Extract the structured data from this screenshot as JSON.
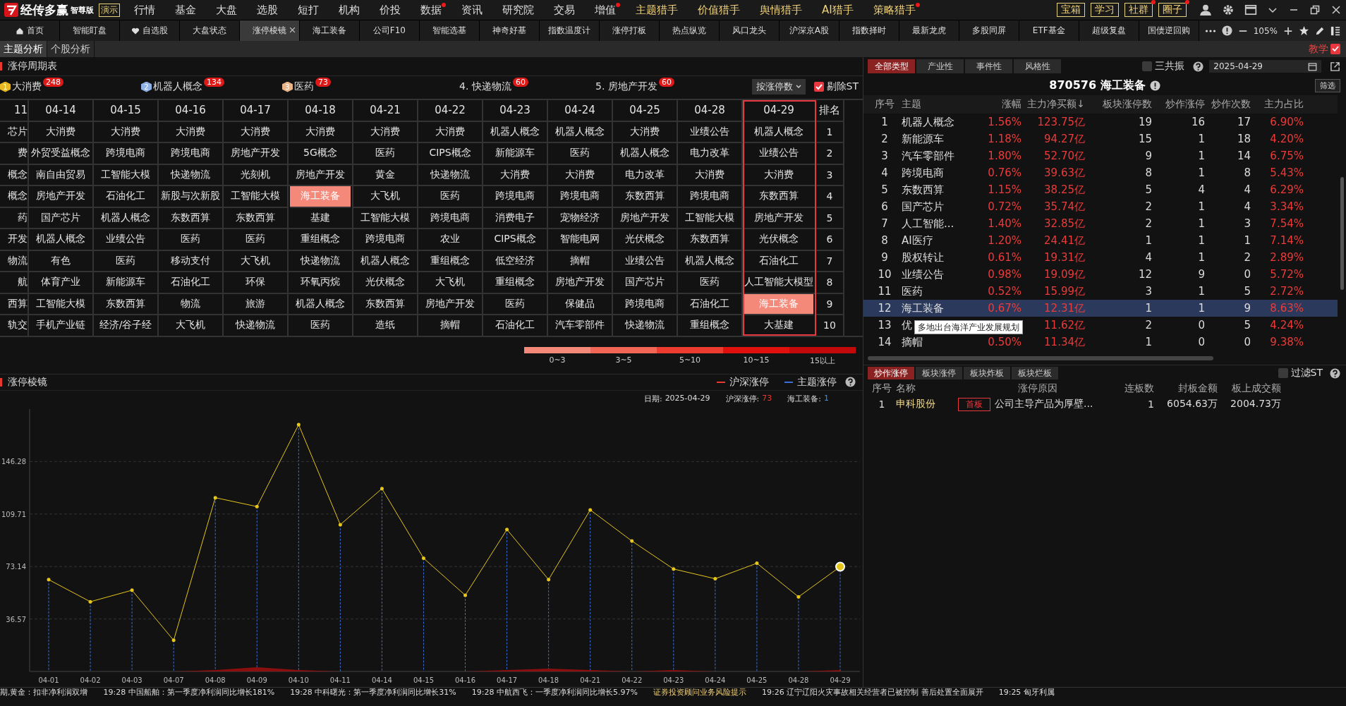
{
  "app": {
    "name": "经传多赢",
    "edition": "智尊版",
    "demo": "演示"
  },
  "nav": [
    {
      "label": "行情",
      "dot": false
    },
    {
      "label": "基金",
      "dot": false
    },
    {
      "label": "大盘",
      "dot": false
    },
    {
      "label": "选股",
      "dot": false
    },
    {
      "label": "短打",
      "dot": false
    },
    {
      "label": "机构",
      "dot": false
    },
    {
      "label": "价投",
      "dot": false
    },
    {
      "label": "数据",
      "dot": true
    },
    {
      "label": "资讯",
      "dot": false
    },
    {
      "label": "研究院",
      "dot": false
    },
    {
      "label": "交易",
      "dot": false
    },
    {
      "label": "增值",
      "dot": true
    },
    {
      "label": "主题猎手",
      "dot": false
    },
    {
      "label": "价值猎手",
      "dot": false
    },
    {
      "label": "舆情猎手",
      "dot": false
    },
    {
      "label": "AI猎手",
      "dot": false
    },
    {
      "label": "策略猎手",
      "dot": true
    }
  ],
  "nav_buttons": [
    {
      "label": "宝箱",
      "dot": false
    },
    {
      "label": "学习",
      "dot": false
    },
    {
      "label": "社群",
      "dot": true
    },
    {
      "label": "圈子",
      "dot": true
    }
  ],
  "tabs": [
    {
      "label": "首页",
      "selected": false
    },
    {
      "label": "智能盯盘",
      "selected": false
    },
    {
      "label": "自选股",
      "selected": false
    },
    {
      "label": "大盘状态",
      "selected": false
    },
    {
      "label": "涨停棱镜",
      "selected": true
    },
    {
      "label": "海工装备",
      "selected": false
    },
    {
      "label": "公司F10",
      "selected": false
    },
    {
      "label": "智能选基",
      "selected": false
    },
    {
      "label": "神奇好基",
      "selected": false
    },
    {
      "label": "指数温度计",
      "selected": false
    },
    {
      "label": "涨停打板",
      "selected": false
    },
    {
      "label": "热点纵览",
      "selected": false
    },
    {
      "label": "风口龙头",
      "selected": false
    },
    {
      "label": "沪深京A股",
      "selected": false
    },
    {
      "label": "指数择时",
      "selected": false
    },
    {
      "label": "最新龙虎",
      "selected": false
    },
    {
      "label": "多股同屏",
      "selected": false
    },
    {
      "label": "ETF基金",
      "selected": false
    },
    {
      "label": "超级复盘",
      "selected": false
    },
    {
      "label": "国债逆回购",
      "selected": false
    }
  ],
  "zoom": "105%",
  "subtabs": [
    {
      "label": "主题分析",
      "selected": true
    },
    {
      "label": "个股分析",
      "selected": false
    }
  ],
  "teach": "教学",
  "cycle_table": {
    "title": "涨停周期表",
    "top_themes": [
      {
        "kind": "medal",
        "rank": "1",
        "color": "#e8b923",
        "name": "大消费",
        "count": "248"
      },
      {
        "kind": "medal",
        "rank": "2",
        "color": "#8fb3e8",
        "name": "机器人概念",
        "count": "134"
      },
      {
        "kind": "medal",
        "rank": "3",
        "color": "#e8b48a",
        "name": "医药",
        "count": "73"
      },
      {
        "kind": "plain",
        "name": "4. 快递物流",
        "count": "60"
      },
      {
        "kind": "plain",
        "name": "5. 房地产开发",
        "count": "60"
      }
    ],
    "sort": "按涨停数",
    "exclude_st": {
      "label": "剔除ST",
      "checked": true
    },
    "columns": [
      {
        "date": "11",
        "selected": false,
        "cells": [
          {
            "text": "芯片",
            "hot": false
          },
          {
            "text": "费",
            "hot": false
          },
          {
            "text": "概念",
            "hot": false
          },
          {
            "text": "概念",
            "hot": false
          },
          {
            "text": "药",
            "hot": false
          },
          {
            "text": "开发",
            "hot": false
          },
          {
            "text": "物流",
            "hot": false
          },
          {
            "text": "航",
            "hot": false
          },
          {
            "text": "西算",
            "hot": false
          },
          {
            "text": "轨交",
            "hot": false
          }
        ]
      },
      {
        "date": "04-14",
        "selected": false,
        "cells": [
          {
            "text": "大消费",
            "hot": false
          },
          {
            "text": "外贸受益概念",
            "hot": false
          },
          {
            "text": "南自由贸易",
            "hot": false
          },
          {
            "text": "房地产开发",
            "hot": false
          },
          {
            "text": "国产芯片",
            "hot": false
          },
          {
            "text": "机器人概念",
            "hot": false
          },
          {
            "text": "有色",
            "hot": false
          },
          {
            "text": "体育产业",
            "hot": false
          },
          {
            "text": "工智能大模",
            "hot": false
          },
          {
            "text": "手机产业链",
            "hot": false
          }
        ]
      },
      {
        "date": "04-15",
        "selected": false,
        "cells": [
          {
            "text": "大消费",
            "hot": false
          },
          {
            "text": "跨境电商",
            "hot": false
          },
          {
            "text": "工智能大模",
            "hot": false
          },
          {
            "text": "石油化工",
            "hot": false
          },
          {
            "text": "机器人概念",
            "hot": false
          },
          {
            "text": "业绩公告",
            "hot": false
          },
          {
            "text": "医药",
            "hot": false
          },
          {
            "text": "新能源车",
            "hot": false
          },
          {
            "text": "东数西算",
            "hot": false
          },
          {
            "text": "经济/谷子经",
            "hot": false
          }
        ]
      },
      {
        "date": "04-16",
        "selected": false,
        "cells": [
          {
            "text": "大消费",
            "hot": false
          },
          {
            "text": "跨境电商",
            "hot": false
          },
          {
            "text": "快递物流",
            "hot": false
          },
          {
            "text": "新股与次新股",
            "hot": false
          },
          {
            "text": "东数西算",
            "hot": false
          },
          {
            "text": "医药",
            "hot": false
          },
          {
            "text": "移动支付",
            "hot": false
          },
          {
            "text": "石油化工",
            "hot": false
          },
          {
            "text": "物流",
            "hot": false
          },
          {
            "text": "大飞机",
            "hot": false
          }
        ]
      },
      {
        "date": "04-17",
        "selected": false,
        "cells": [
          {
            "text": "大消费",
            "hot": false
          },
          {
            "text": "房地产开发",
            "hot": false
          },
          {
            "text": "光刻机",
            "hot": false
          },
          {
            "text": "工智能大模",
            "hot": false
          },
          {
            "text": "东数西算",
            "hot": false
          },
          {
            "text": "医药",
            "hot": false
          },
          {
            "text": "大飞机",
            "hot": false
          },
          {
            "text": "环保",
            "hot": false
          },
          {
            "text": "旅游",
            "hot": false
          },
          {
            "text": "快递物流",
            "hot": false
          }
        ]
      },
      {
        "date": "04-18",
        "selected": false,
        "cells": [
          {
            "text": "大消费",
            "hot": false
          },
          {
            "text": "5G概念",
            "hot": false
          },
          {
            "text": "房地产开发",
            "hot": false
          },
          {
            "text": "海工装备",
            "hot": true
          },
          {
            "text": "基建",
            "hot": false
          },
          {
            "text": "重组概念",
            "hot": false
          },
          {
            "text": "快递物流",
            "hot": false
          },
          {
            "text": "环氧丙烷",
            "hot": false
          },
          {
            "text": "机器人概念",
            "hot": false
          },
          {
            "text": "医药",
            "hot": false
          }
        ]
      },
      {
        "date": "04-21",
        "selected": false,
        "cells": [
          {
            "text": "大消费",
            "hot": false
          },
          {
            "text": "医药",
            "hot": false
          },
          {
            "text": "黄金",
            "hot": false
          },
          {
            "text": "大飞机",
            "hot": false
          },
          {
            "text": "工智能大模",
            "hot": false
          },
          {
            "text": "跨境电商",
            "hot": false
          },
          {
            "text": "机器人概念",
            "hot": false
          },
          {
            "text": "光伏概念",
            "hot": false
          },
          {
            "text": "东数西算",
            "hot": false
          },
          {
            "text": "造纸",
            "hot": false
          }
        ]
      },
      {
        "date": "04-22",
        "selected": false,
        "cells": [
          {
            "text": "大消费",
            "hot": false
          },
          {
            "text": "CIPS概念",
            "hot": false
          },
          {
            "text": "快递物流",
            "hot": false
          },
          {
            "text": "医药",
            "hot": false
          },
          {
            "text": "跨境电商",
            "hot": false
          },
          {
            "text": "农业",
            "hot": false
          },
          {
            "text": "重组概念",
            "hot": false
          },
          {
            "text": "大飞机",
            "hot": false
          },
          {
            "text": "房地产开发",
            "hot": false
          },
          {
            "text": "摘帽",
            "hot": false
          }
        ]
      },
      {
        "date": "04-23",
        "selected": false,
        "cells": [
          {
            "text": "机器人概念",
            "hot": false
          },
          {
            "text": "新能源车",
            "hot": false
          },
          {
            "text": "大消费",
            "hot": false
          },
          {
            "text": "跨境电商",
            "hot": false
          },
          {
            "text": "消费电子",
            "hot": false
          },
          {
            "text": "CIPS概念",
            "hot": false
          },
          {
            "text": "低空经济",
            "hot": false
          },
          {
            "text": "重组概念",
            "hot": false
          },
          {
            "text": "医药",
            "hot": false
          },
          {
            "text": "石油化工",
            "hot": false
          }
        ]
      },
      {
        "date": "04-24",
        "selected": false,
        "cells": [
          {
            "text": "机器人概念",
            "hot": false
          },
          {
            "text": "医药",
            "hot": false
          },
          {
            "text": "大消费",
            "hot": false
          },
          {
            "text": "跨境电商",
            "hot": false
          },
          {
            "text": "宠物经济",
            "hot": false
          },
          {
            "text": "智能电网",
            "hot": false
          },
          {
            "text": "摘帽",
            "hot": false
          },
          {
            "text": "房地产开发",
            "hot": false
          },
          {
            "text": "保健品",
            "hot": false
          },
          {
            "text": "汽车零部件",
            "hot": false
          }
        ]
      },
      {
        "date": "04-25",
        "selected": false,
        "cells": [
          {
            "text": "大消费",
            "hot": false
          },
          {
            "text": "机器人概念",
            "hot": false
          },
          {
            "text": "电力改革",
            "hot": false
          },
          {
            "text": "东数西算",
            "hot": false
          },
          {
            "text": "房地产开发",
            "hot": false
          },
          {
            "text": "光伏概念",
            "hot": false
          },
          {
            "text": "业绩公告",
            "hot": false
          },
          {
            "text": "国产芯片",
            "hot": false
          },
          {
            "text": "跨境电商",
            "hot": false
          },
          {
            "text": "快递物流",
            "hot": false
          }
        ]
      },
      {
        "date": "04-28",
        "selected": false,
        "cells": [
          {
            "text": "业绩公告",
            "hot": false
          },
          {
            "text": "电力改革",
            "hot": false
          },
          {
            "text": "大消费",
            "hot": false
          },
          {
            "text": "跨境电商",
            "hot": false
          },
          {
            "text": "工智能大模",
            "hot": false
          },
          {
            "text": "东数西算",
            "hot": false
          },
          {
            "text": "机器人概念",
            "hot": false
          },
          {
            "text": "医药",
            "hot": false
          },
          {
            "text": "石油化工",
            "hot": false
          },
          {
            "text": "重组概念",
            "hot": false
          }
        ]
      },
      {
        "date": "04-29",
        "selected": true,
        "cells": [
          {
            "text": "机器人概念",
            "hot": false
          },
          {
            "text": "业绩公告",
            "hot": false
          },
          {
            "text": "大消费",
            "hot": false
          },
          {
            "text": "东数西算",
            "hot": false
          },
          {
            "text": "房地产开发",
            "hot": false
          },
          {
            "text": "光伏概念",
            "hot": false
          },
          {
            "text": "石油化工",
            "hot": false
          },
          {
            "text": "人工智能大模型",
            "hot": false
          },
          {
            "text": "海工装备",
            "hot": true
          },
          {
            "text": "大基建",
            "hot": false
          }
        ]
      }
    ],
    "rank_header": "排名",
    "ranks": [
      "1",
      "2",
      "3",
      "4",
      "5",
      "6",
      "7",
      "8",
      "9",
      "10"
    ],
    "legend": [
      {
        "label": "0~3",
        "color": "#f4897a"
      },
      {
        "label": "3~5",
        "color": "#f26655"
      },
      {
        "label": "5~10",
        "color": "#ee3b30"
      },
      {
        "label": "10~15",
        "color": "#e0100c"
      },
      {
        "label": "15以上",
        "color": "#c20a0a"
      }
    ]
  },
  "prism": {
    "title": "涨停棱镜",
    "legend": [
      {
        "color": "#e8382f"
      },
      {
        "color": "#3a6fd8"
      }
    ],
    "info": [
      {
        "label": "日期:",
        "value": "2025-04-29",
        "color": "#dddddd"
      },
      {
        "label": "沪深涨停:",
        "value": "73",
        "color": "#e8382f"
      },
      {
        "label": "海工装备:",
        "value": "1",
        "color": "#3a8ff0"
      }
    ],
    "chart_data": {
      "type": "line",
      "categories": [
        "04-01",
        "04-02",
        "04-03",
        "04-07",
        "04-08",
        "04-09",
        "04-10",
        "04-11",
        "04-14",
        "04-15",
        "04-16",
        "04-17",
        "04-18",
        "04-21",
        "04-22",
        "04-23",
        "04-24",
        "04-25",
        "04-28",
        "04-29"
      ],
      "series": [
        {
          "name": "沪深涨停",
          "type": "line",
          "color": "#e6c619",
          "values": [
            64,
            48.6,
            56.6,
            21.7,
            121.1,
            114.9,
            172,
            102.3,
            127.4,
            78.9,
            53.1,
            98.9,
            64,
            112.6,
            90.9,
            71.4,
            64.6,
            75.4,
            52,
            73
          ]
        },
        {
          "name": "主题涨停",
          "type": "area",
          "color": "#8b0f0f",
          "values": [
            0,
            0,
            0,
            0,
            1,
            3,
            1,
            0,
            0,
            0,
            0,
            1,
            2,
            1,
            0,
            1,
            0,
            0,
            0,
            1
          ]
        }
      ],
      "ylim": [
        0,
        182.85
      ],
      "grid": true,
      "yticks": [
        36.57,
        73.14,
        109.71,
        146.28
      ]
    }
  },
  "theme_panel": {
    "types": [
      {
        "label": "全部类型",
        "selected": true
      },
      {
        "label": "产业性",
        "selected": false
      },
      {
        "label": "事件性",
        "selected": false
      },
      {
        "label": "风格性",
        "selected": false
      }
    ],
    "resonance": {
      "label": "三共振",
      "checked": false
    },
    "date": "2025-04-29",
    "title": "870576 海工装备",
    "filter": "筛选",
    "columns": [
      "序号",
      "主题",
      "涨幅",
      "主力净买额↓",
      "板块涨停数",
      "炒作涨停",
      "炒作次数",
      "主力占比"
    ],
    "rows": [
      {
        "no": "1",
        "theme": "机器人概念",
        "change": "1.56%",
        "net": "123.75亿",
        "limit_ups": "19",
        "hype_ups": "16",
        "hype_times": "17",
        "share": "6.90%",
        "selected": false
      },
      {
        "no": "2",
        "theme": "新能源车",
        "change": "1.18%",
        "net": "94.27亿",
        "limit_ups": "15",
        "hype_ups": "1",
        "hype_times": "18",
        "share": "4.20%",
        "selected": false
      },
      {
        "no": "3",
        "theme": "汽车零部件",
        "change": "1.80%",
        "net": "52.70亿",
        "limit_ups": "9",
        "hype_ups": "1",
        "hype_times": "14",
        "share": "6.75%",
        "selected": false
      },
      {
        "no": "4",
        "theme": "跨境电商",
        "change": "0.76%",
        "net": "39.63亿",
        "limit_ups": "8",
        "hype_ups": "1",
        "hype_times": "8",
        "share": "5.43%",
        "selected": false
      },
      {
        "no": "5",
        "theme": "东数西算",
        "change": "1.15%",
        "net": "38.25亿",
        "limit_ups": "5",
        "hype_ups": "4",
        "hype_times": "4",
        "share": "6.29%",
        "selected": false
      },
      {
        "no": "6",
        "theme": "国产芯片",
        "change": "0.72%",
        "net": "35.74亿",
        "limit_ups": "2",
        "hype_ups": "1",
        "hype_times": "4",
        "share": "3.34%",
        "selected": false
      },
      {
        "no": "7",
        "theme": "人工智能...",
        "change": "1.40%",
        "net": "32.85亿",
        "limit_ups": "2",
        "hype_ups": "1",
        "hype_times": "3",
        "share": "7.54%",
        "selected": false
      },
      {
        "no": "8",
        "theme": "AI医疗",
        "change": "1.20%",
        "net": "24.41亿",
        "limit_ups": "1",
        "hype_ups": "1",
        "hype_times": "1",
        "share": "7.14%",
        "selected": false
      },
      {
        "no": "9",
        "theme": "股权转让",
        "change": "0.61%",
        "net": "19.31亿",
        "limit_ups": "4",
        "hype_ups": "1",
        "hype_times": "2",
        "share": "2.89%",
        "selected": false
      },
      {
        "no": "10",
        "theme": "业绩公告",
        "change": "0.98%",
        "net": "19.09亿",
        "limit_ups": "12",
        "hype_ups": "9",
        "hype_times": "0",
        "share": "5.72%",
        "selected": false
      },
      {
        "no": "11",
        "theme": "医药",
        "change": "0.52%",
        "net": "15.99亿",
        "limit_ups": "3",
        "hype_ups": "1",
        "hype_times": "5",
        "share": "2.72%",
        "selected": false
      },
      {
        "no": "12",
        "theme": "海工装备",
        "change": "0.67%",
        "net": "12.31亿",
        "limit_ups": "1",
        "hype_ups": "1",
        "hype_times": "9",
        "share": "8.63%",
        "selected": true
      },
      {
        "no": "13",
        "theme": "优",
        "net": "11.62亿",
        "limit_ups": "2",
        "hype_ups": "0",
        "hype_times": "5",
        "share": "4.24%",
        "selected": false
      },
      {
        "no": "14",
        "theme": "摘帽",
        "change": "0.50%",
        "net": "11.34亿",
        "limit_ups": "1",
        "hype_ups": "0",
        "hype_times": "0",
        "share": "9.38%",
        "selected": false
      }
    ],
    "tooltip": "多地出台海洋产业发展规划"
  },
  "stock_panel": {
    "tabs": [
      {
        "label": "炒作涨停",
        "selected": true
      },
      {
        "label": "板块涨停",
        "selected": false
      },
      {
        "label": "板块炸板",
        "selected": false
      },
      {
        "label": "板块烂板",
        "selected": false
      }
    ],
    "filter_st": {
      "label": "过滤ST",
      "checked": false
    },
    "columns": [
      "序号",
      "名称",
      "涨停原因",
      "连板数",
      "封板金额",
      "板上成交额"
    ],
    "rows": [
      {
        "no": "1",
        "name": "申科股份",
        "tag": "首板",
        "reason": "公司主导产品为厚壁...",
        "boards": "1",
        "seal": "6054.63万",
        "volume": "2004.73万"
      }
    ]
  },
  "ticker": [
    {
      "kind": "news",
      "text": "期,黄金：扣非净利润双增"
    },
    {
      "kind": "news",
      "text": "19:28 中国船舶：第一季度净利润同比增长181%"
    },
    {
      "kind": "news",
      "text": "19:28 中科曙光：第一季度净利润同比增长31%"
    },
    {
      "kind": "news",
      "text": "19:28 中航西飞：一季度净利润同比增长5.97%"
    },
    {
      "kind": "notice",
      "text": "证券投资顾问业务风险提示"
    },
    {
      "kind": "news",
      "text": "19:26 辽宁辽阳火灾事故相关经营者已被控制 善后处置全面展开"
    },
    {
      "kind": "news",
      "text": "19:25 匈牙利属"
    }
  ]
}
